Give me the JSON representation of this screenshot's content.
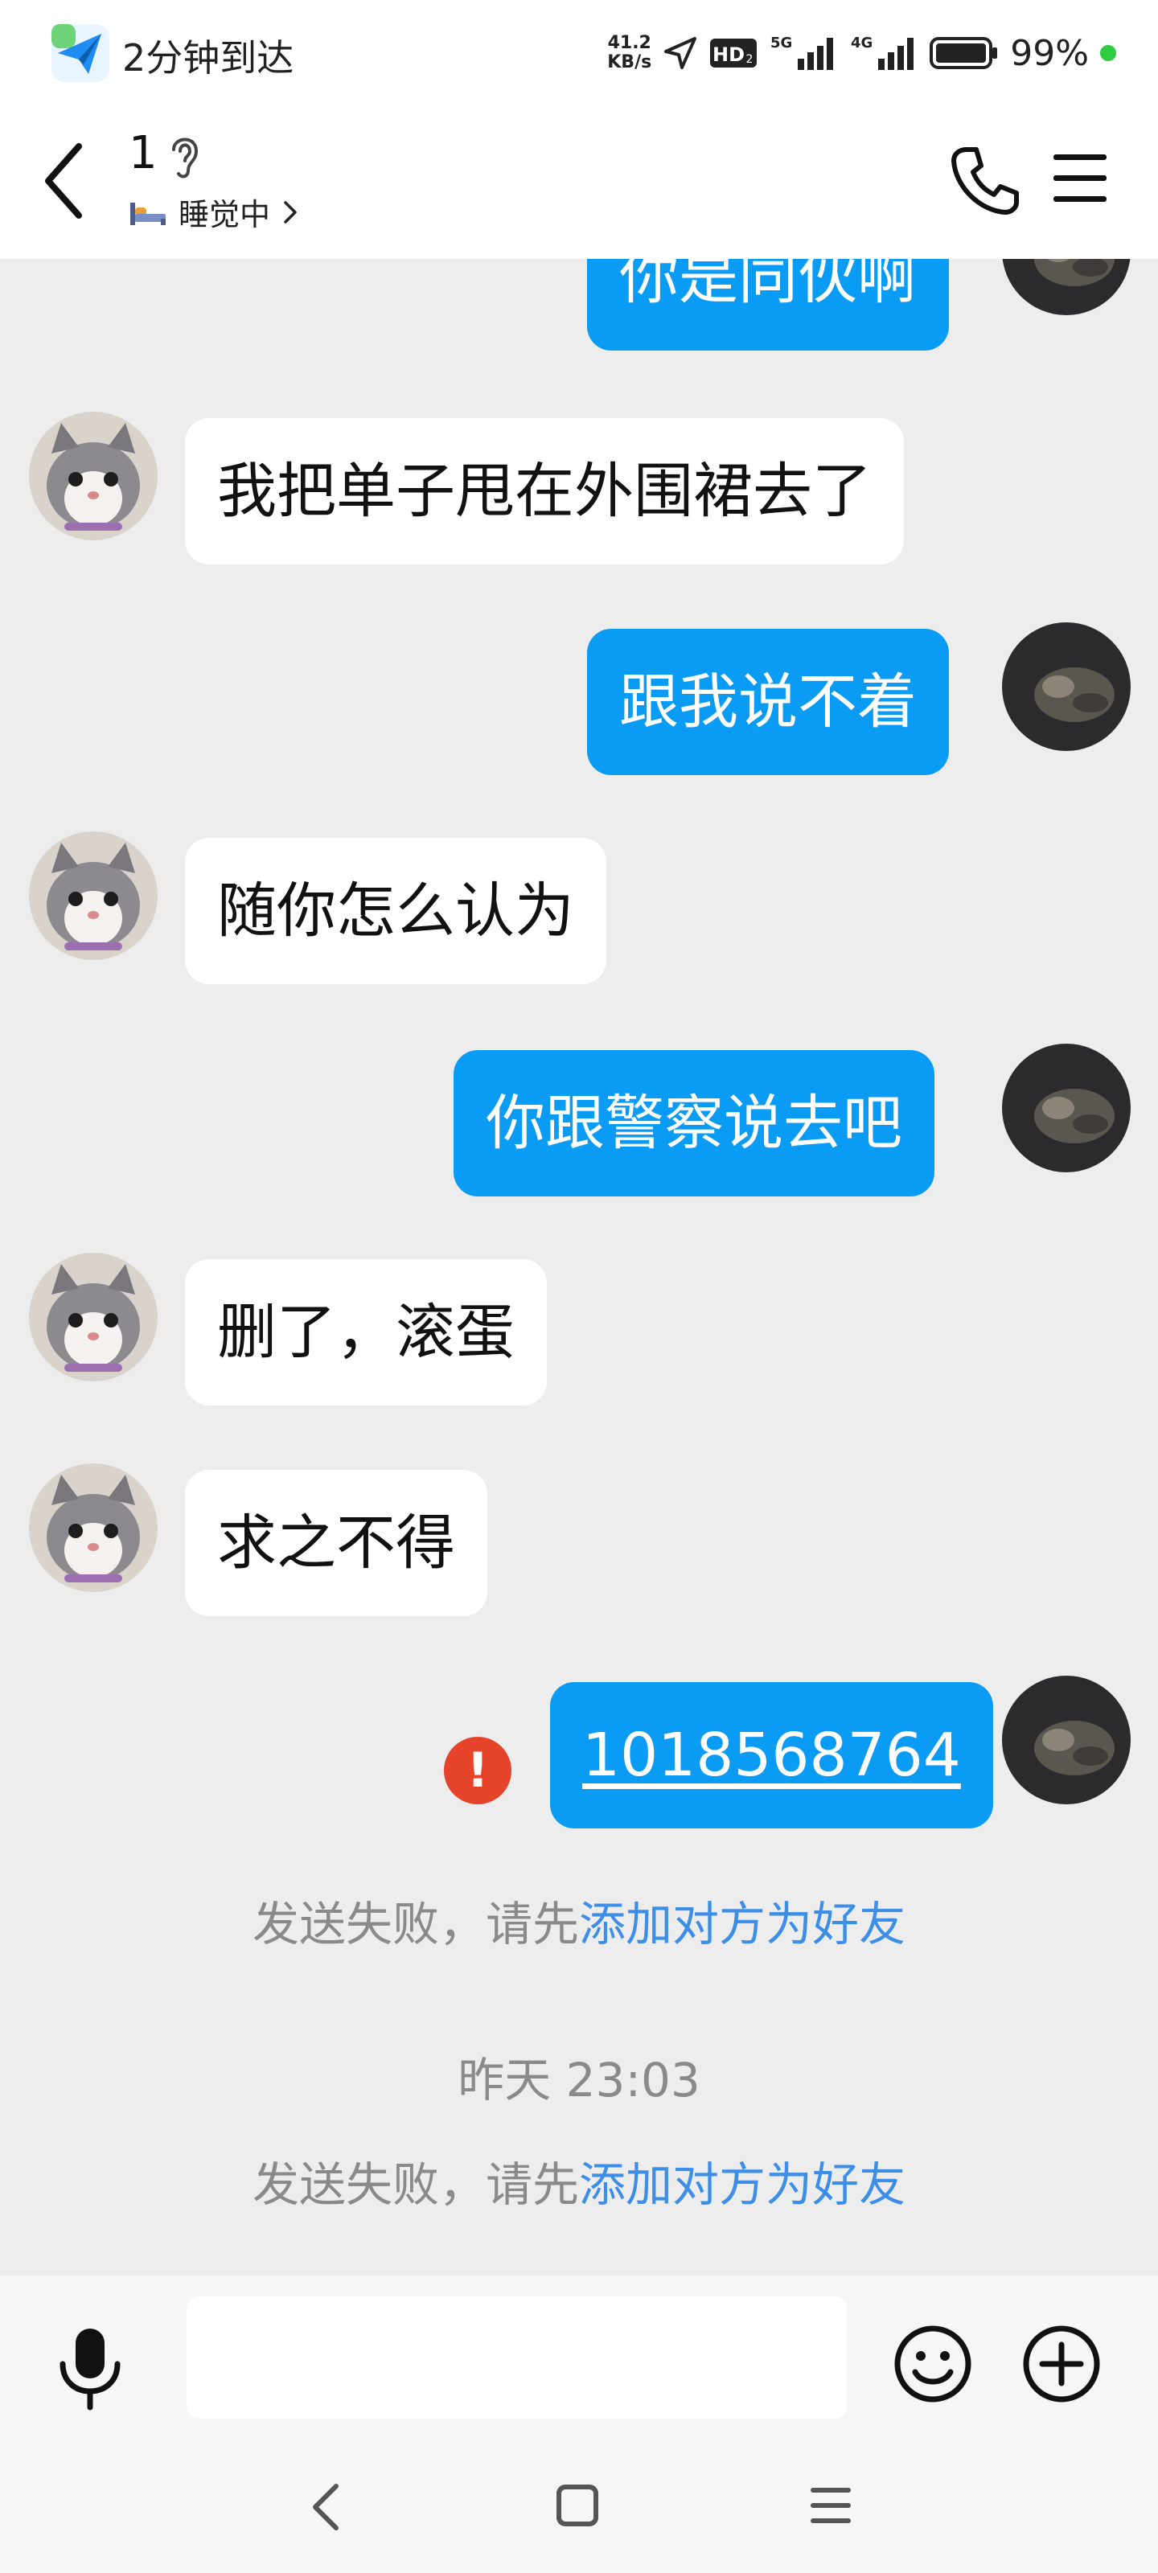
{
  "status_bar": {
    "app_icon": "paper-plane-app-icon",
    "left_text": "2分钟到达",
    "net_speed_top": "41.2",
    "net_speed_bottom": "KB/s",
    "hd_badge": "HD",
    "network_5g": "5G",
    "network_4g": "4G",
    "battery_text": "99%",
    "dot_color": "#2ecc40"
  },
  "header": {
    "contact_name": "1",
    "status": "睡觉中",
    "icons": [
      "back-arrow-icon",
      "ear-icon",
      "bed-icon",
      "phone-icon",
      "hamburger-menu-icon"
    ]
  },
  "messages": [
    {
      "side": "out",
      "text": "你是同伙啊"
    },
    {
      "side": "in",
      "text": "我把单子甩在外围裙去了"
    },
    {
      "side": "out",
      "text": "跟我说不着"
    },
    {
      "side": "in",
      "text": "随你怎么认为"
    },
    {
      "side": "out",
      "text": "你跟警察说去吧"
    },
    {
      "side": "in",
      "text": "删了，滚蛋"
    },
    {
      "side": "in",
      "text": "求之不得"
    },
    {
      "side": "out",
      "text": "1018568764",
      "failed": true,
      "error_icon": "!"
    }
  ],
  "system": {
    "fail_prefix_1": "发送失败，请先",
    "fail_link_1": "添加对方为好友",
    "timestamp": "昨天 23:03",
    "fail_prefix_2": "发送失败，请先",
    "fail_link_2": "添加对方为好友"
  },
  "input_bar": {
    "placeholder": "",
    "icons": [
      "microphone-icon",
      "smiley-icon",
      "plus-circle-icon"
    ]
  },
  "nav_bar": {
    "icons": [
      "nav-back-icon",
      "nav-home-icon",
      "nav-menu-icon"
    ]
  },
  "colors": {
    "outgoing_bubble": "#0a9bf4",
    "incoming_bubble": "#ffffff",
    "chat_background": "#ededed",
    "link": "#3d8ee6",
    "error": "#e5432a"
  }
}
